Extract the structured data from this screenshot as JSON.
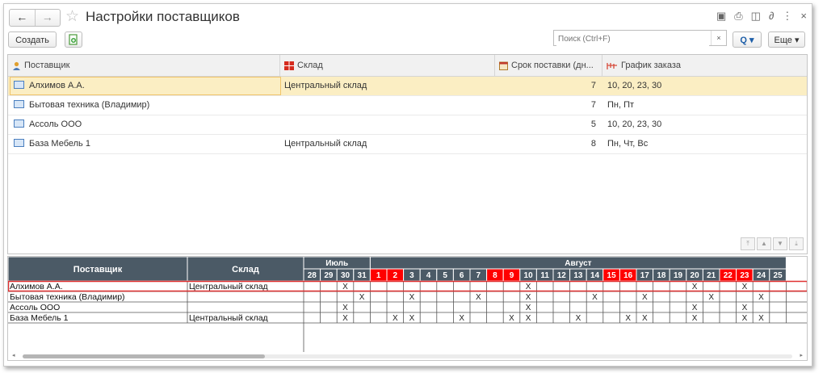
{
  "window": {
    "title": "Настройки поставщиков",
    "nav_back": "←",
    "nav_forward": "→",
    "icons": [
      "save-icon",
      "print-icon",
      "preview-icon",
      "link-icon",
      "more-icon",
      "close-icon"
    ],
    "icon_glyphs": [
      "▣",
      "⎙",
      "◫",
      "∂",
      "⋮",
      "×"
    ]
  },
  "toolbar": {
    "create_label": "Создать",
    "search_placeholder": "Поиск (Ctrl+F)",
    "search_clear": "×",
    "search_btn": "Q ▾",
    "more_label": "Еще ▾"
  },
  "table": {
    "columns": [
      "Поставщик",
      "Склад",
      "Срок поставки (дн...",
      "График заказа"
    ],
    "rows": [
      {
        "supplier": "Алхимов А.А.",
        "warehouse": "Центральный склад",
        "lead_time": "7",
        "schedule": "10, 20, 23, 30"
      },
      {
        "supplier": "Бытовая техника (Владимир)",
        "warehouse": "",
        "lead_time": "7",
        "schedule": "Пн, Пт"
      },
      {
        "supplier": "Ассоль ООО",
        "warehouse": "",
        "lead_time": "5",
        "schedule": "10, 20, 23, 30"
      },
      {
        "supplier": "База Мебель 1",
        "warehouse": "Центральный склад",
        "lead_time": "8",
        "schedule": "Пн, Чт, Вс"
      }
    ],
    "selected_row": 0,
    "nav_buttons": [
      "⤒",
      "▲",
      "▼",
      "⤓"
    ]
  },
  "calendar": {
    "col_supplier": "Поставщик",
    "col_warehouse": "Склад",
    "months": [
      {
        "name": "Июль",
        "days": [
          28,
          29,
          30,
          31
        ]
      },
      {
        "name": "Август",
        "days": [
          1,
          2,
          3,
          4,
          5,
          6,
          7,
          8,
          9,
          10,
          11,
          12,
          13,
          14,
          15,
          16,
          17,
          18,
          19,
          20,
          21,
          22,
          23,
          24,
          25
        ]
      }
    ],
    "red_days": [
      1,
      2,
      8,
      9,
      15,
      16,
      22,
      23
    ],
    "mark": "X",
    "rows": [
      {
        "supplier": "Алхимов А.А.",
        "warehouse": "Центральный склад",
        "marks": [
          30,
          10,
          20,
          23
        ]
      },
      {
        "supplier": "Бытовая техника (Владимир)",
        "warehouse": "",
        "marks": [
          31,
          3,
          7,
          10,
          14,
          17,
          21,
          24
        ]
      },
      {
        "supplier": "Ассоль ООО",
        "warehouse": "",
        "marks": [
          30,
          10,
          20,
          23
        ]
      },
      {
        "supplier": "База Мебель 1",
        "warehouse": "Центральный склад",
        "marks": [
          30,
          2,
          3,
          6,
          9,
          10,
          13,
          16,
          17,
          20,
          23,
          24
        ]
      }
    ],
    "colors": {
      "header": "#4b5a66",
      "red": "#ff0000",
      "selected_border": "#e03030"
    }
  }
}
